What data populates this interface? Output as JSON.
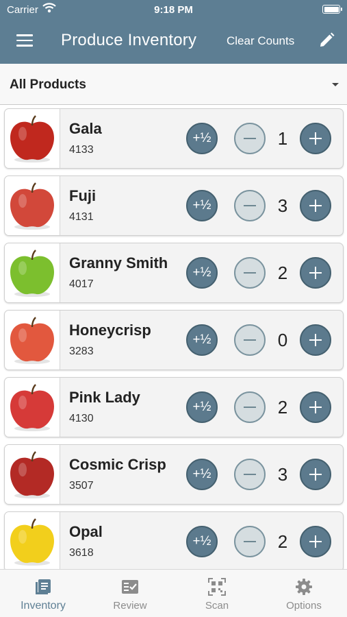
{
  "status_bar": {
    "carrier": "Carrier",
    "time": "9:18 PM"
  },
  "header": {
    "title": "Produce Inventory",
    "clear_label": "Clear Counts",
    "menu_icon": "hamburger-menu-icon",
    "edit_icon": "pencil-icon"
  },
  "filter": {
    "label": "All Products"
  },
  "half_label": "+½",
  "products": [
    {
      "name": "Gala",
      "plu": "4133",
      "count": "1",
      "color": "#c0281e"
    },
    {
      "name": "Fuji",
      "plu": "4131",
      "count": "3",
      "color": "#d2483a"
    },
    {
      "name": "Granny Smith",
      "plu": "4017",
      "count": "2",
      "color": "#7cbf2e"
    },
    {
      "name": "Honeycrisp",
      "plu": "3283",
      "count": "0",
      "color": "#e2583e"
    },
    {
      "name": "Pink Lady",
      "plu": "4130",
      "count": "2",
      "color": "#d63a38"
    },
    {
      "name": "Cosmic Crisp",
      "plu": "3507",
      "count": "3",
      "color": "#b32a25"
    },
    {
      "name": "Opal",
      "plu": "3618",
      "count": "2",
      "color": "#f2cf1c"
    }
  ],
  "tabs": [
    {
      "label": "Inventory",
      "icon": "inventory-book-icon",
      "active": true
    },
    {
      "label": "Review",
      "icon": "review-check-icon",
      "active": false
    },
    {
      "label": "Scan",
      "icon": "qr-scan-icon",
      "active": false
    },
    {
      "label": "Options",
      "icon": "gear-icon",
      "active": false
    }
  ],
  "colors": {
    "header": "#5d7e93",
    "accent": "#5e7f94",
    "button": "#5c7a8d"
  }
}
